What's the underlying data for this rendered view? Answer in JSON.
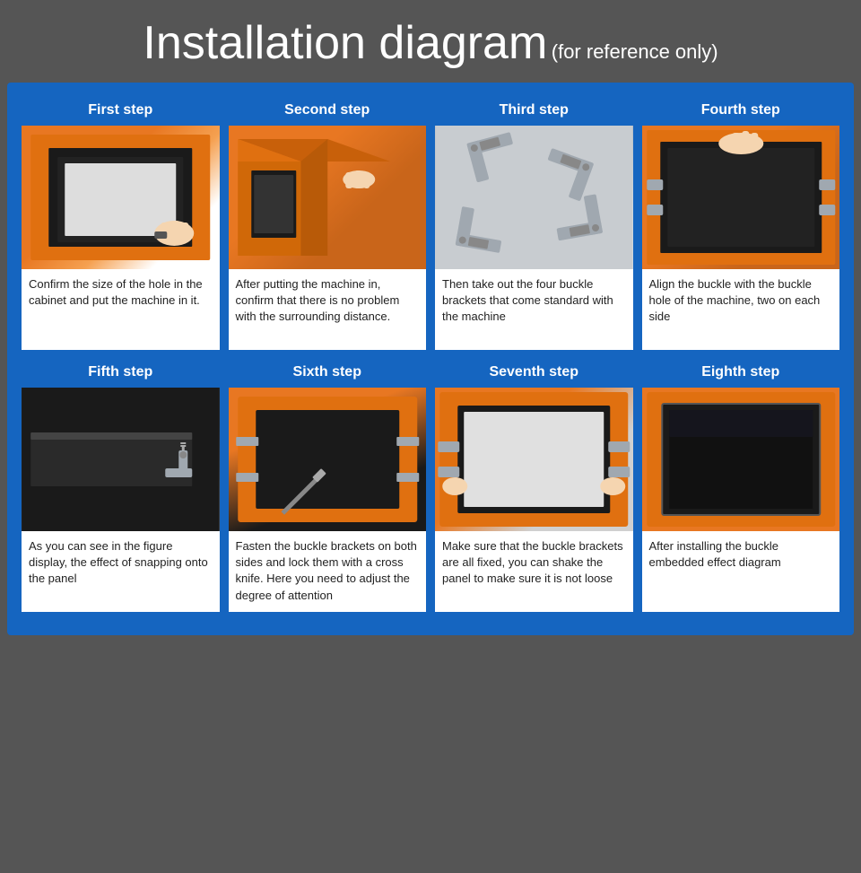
{
  "title": "Installation diagram",
  "subtitle": "(for reference only)",
  "steps": [
    {
      "id": 1,
      "label": "First step",
      "description": "Confirm the size of the hole in the cabinet and put the machine in it."
    },
    {
      "id": 2,
      "label": "Second step",
      "description": "After putting the machine in, confirm that there is no problem with the surrounding distance."
    },
    {
      "id": 3,
      "label": "Third step",
      "description": "Then take out the four buckle brackets that come standard with the machine"
    },
    {
      "id": 4,
      "label": "Fourth step",
      "description": "Align the buckle with the buckle hole of the machine, two on each side"
    },
    {
      "id": 5,
      "label": "Fifth step",
      "description": "As you can see in the figure display, the effect of snapping onto the panel"
    },
    {
      "id": 6,
      "label": "Sixth step",
      "description": "Fasten the buckle brackets on both sides and lock them with a cross knife. Here you need to adjust the degree of attention"
    },
    {
      "id": 7,
      "label": "Seventh step",
      "description": "Make sure that the buckle brackets are all fixed, you can shake the panel to make sure it is not loose"
    },
    {
      "id": 8,
      "label": "Eighth step",
      "description": "After installing the buckle embedded effect diagram"
    }
  ]
}
